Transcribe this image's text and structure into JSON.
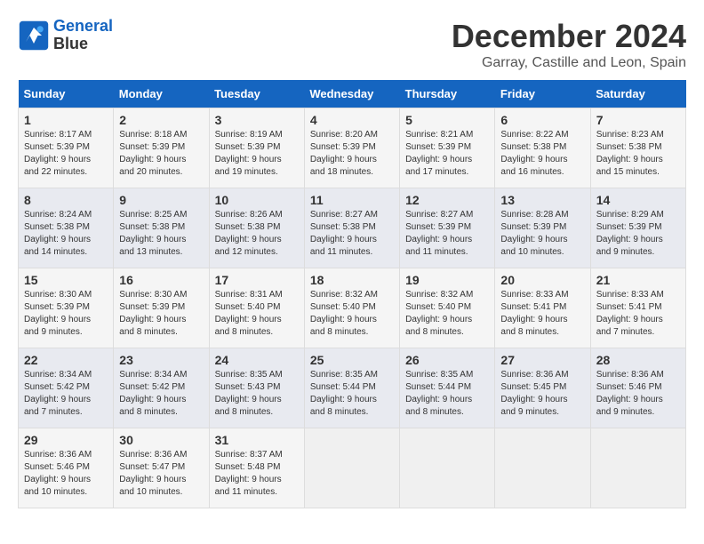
{
  "logo": {
    "line1": "General",
    "line2": "Blue"
  },
  "title": "December 2024",
  "subtitle": "Garray, Castille and Leon, Spain",
  "days_header": [
    "Sunday",
    "Monday",
    "Tuesday",
    "Wednesday",
    "Thursday",
    "Friday",
    "Saturday"
  ],
  "weeks": [
    [
      {
        "day": "1",
        "sunrise": "8:17 AM",
        "sunset": "5:39 PM",
        "daylight": "9 hours and 22 minutes."
      },
      {
        "day": "2",
        "sunrise": "8:18 AM",
        "sunset": "5:39 PM",
        "daylight": "9 hours and 20 minutes."
      },
      {
        "day": "3",
        "sunrise": "8:19 AM",
        "sunset": "5:39 PM",
        "daylight": "9 hours and 19 minutes."
      },
      {
        "day": "4",
        "sunrise": "8:20 AM",
        "sunset": "5:39 PM",
        "daylight": "9 hours and 18 minutes."
      },
      {
        "day": "5",
        "sunrise": "8:21 AM",
        "sunset": "5:39 PM",
        "daylight": "9 hours and 17 minutes."
      },
      {
        "day": "6",
        "sunrise": "8:22 AM",
        "sunset": "5:38 PM",
        "daylight": "9 hours and 16 minutes."
      },
      {
        "day": "7",
        "sunrise": "8:23 AM",
        "sunset": "5:38 PM",
        "daylight": "9 hours and 15 minutes."
      }
    ],
    [
      {
        "day": "8",
        "sunrise": "8:24 AM",
        "sunset": "5:38 PM",
        "daylight": "9 hours and 14 minutes."
      },
      {
        "day": "9",
        "sunrise": "8:25 AM",
        "sunset": "5:38 PM",
        "daylight": "9 hours and 13 minutes."
      },
      {
        "day": "10",
        "sunrise": "8:26 AM",
        "sunset": "5:38 PM",
        "daylight": "9 hours and 12 minutes."
      },
      {
        "day": "11",
        "sunrise": "8:27 AM",
        "sunset": "5:38 PM",
        "daylight": "9 hours and 11 minutes."
      },
      {
        "day": "12",
        "sunrise": "8:27 AM",
        "sunset": "5:39 PM",
        "daylight": "9 hours and 11 minutes."
      },
      {
        "day": "13",
        "sunrise": "8:28 AM",
        "sunset": "5:39 PM",
        "daylight": "9 hours and 10 minutes."
      },
      {
        "day": "14",
        "sunrise": "8:29 AM",
        "sunset": "5:39 PM",
        "daylight": "9 hours and 9 minutes."
      }
    ],
    [
      {
        "day": "15",
        "sunrise": "8:30 AM",
        "sunset": "5:39 PM",
        "daylight": "9 hours and 9 minutes."
      },
      {
        "day": "16",
        "sunrise": "8:30 AM",
        "sunset": "5:39 PM",
        "daylight": "9 hours and 8 minutes."
      },
      {
        "day": "17",
        "sunrise": "8:31 AM",
        "sunset": "5:40 PM",
        "daylight": "9 hours and 8 minutes."
      },
      {
        "day": "18",
        "sunrise": "8:32 AM",
        "sunset": "5:40 PM",
        "daylight": "9 hours and 8 minutes."
      },
      {
        "day": "19",
        "sunrise": "8:32 AM",
        "sunset": "5:40 PM",
        "daylight": "9 hours and 8 minutes."
      },
      {
        "day": "20",
        "sunrise": "8:33 AM",
        "sunset": "5:41 PM",
        "daylight": "9 hours and 8 minutes."
      },
      {
        "day": "21",
        "sunrise": "8:33 AM",
        "sunset": "5:41 PM",
        "daylight": "9 hours and 7 minutes."
      }
    ],
    [
      {
        "day": "22",
        "sunrise": "8:34 AM",
        "sunset": "5:42 PM",
        "daylight": "9 hours and 7 minutes."
      },
      {
        "day": "23",
        "sunrise": "8:34 AM",
        "sunset": "5:42 PM",
        "daylight": "9 hours and 8 minutes."
      },
      {
        "day": "24",
        "sunrise": "8:35 AM",
        "sunset": "5:43 PM",
        "daylight": "9 hours and 8 minutes."
      },
      {
        "day": "25",
        "sunrise": "8:35 AM",
        "sunset": "5:44 PM",
        "daylight": "9 hours and 8 minutes."
      },
      {
        "day": "26",
        "sunrise": "8:35 AM",
        "sunset": "5:44 PM",
        "daylight": "9 hours and 8 minutes."
      },
      {
        "day": "27",
        "sunrise": "8:36 AM",
        "sunset": "5:45 PM",
        "daylight": "9 hours and 9 minutes."
      },
      {
        "day": "28",
        "sunrise": "8:36 AM",
        "sunset": "5:46 PM",
        "daylight": "9 hours and 9 minutes."
      }
    ],
    [
      {
        "day": "29",
        "sunrise": "8:36 AM",
        "sunset": "5:46 PM",
        "daylight": "9 hours and 10 minutes."
      },
      {
        "day": "30",
        "sunrise": "8:36 AM",
        "sunset": "5:47 PM",
        "daylight": "9 hours and 10 minutes."
      },
      {
        "day": "31",
        "sunrise": "8:37 AM",
        "sunset": "5:48 PM",
        "daylight": "9 hours and 11 minutes."
      },
      null,
      null,
      null,
      null
    ]
  ]
}
